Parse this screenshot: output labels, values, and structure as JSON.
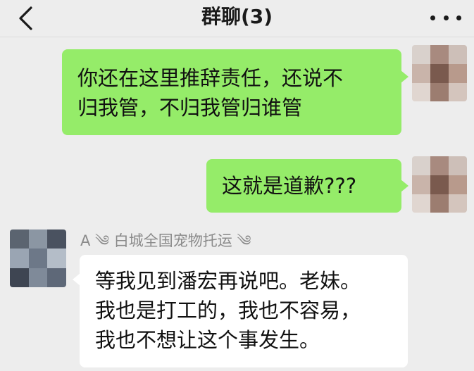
{
  "header": {
    "title": "群聊(3)",
    "back_icon": "chevron-left-icon",
    "more_icon": "more-horizontal-icon"
  },
  "messages": [
    {
      "side": "right",
      "lines": [
        "你还在这里推辞责任，还说不",
        "归我管，不归我管归谁管"
      ]
    },
    {
      "side": "right",
      "lines": [
        "这就是道歉???"
      ]
    },
    {
      "side": "left",
      "sender": "A ༄ 白城全国宠物托运 ༄",
      "lines": [
        "等我见到潘宏再说吧。老妹。",
        "我也是打工的，我也不容易，",
        "我也不想让这个事发生。"
      ]
    }
  ],
  "colors": {
    "background": "#ededed",
    "my_bubble": "#95ec69",
    "other_bubble": "#ffffff",
    "sender_name": "#8a8a8a"
  }
}
